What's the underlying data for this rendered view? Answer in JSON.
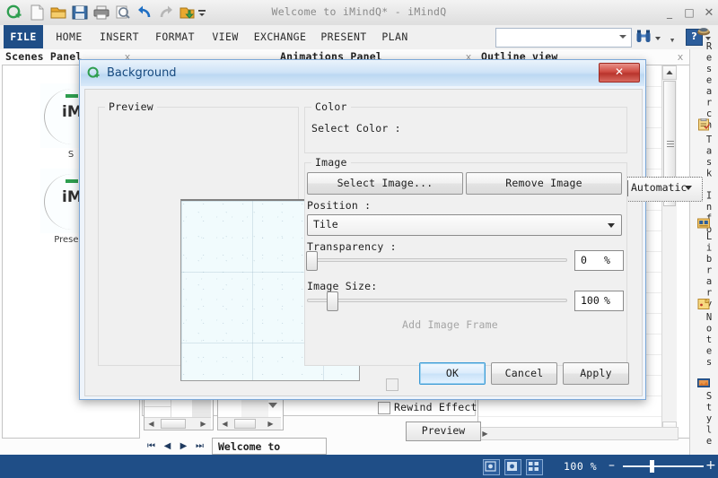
{
  "window": {
    "title": "Welcome to iMindQ* - iMindQ",
    "minimize": "_",
    "maximize": "□",
    "close": "✕"
  },
  "quick_access": {
    "icons": [
      "app-logo-icon",
      "new-document-icon",
      "open-folder-icon",
      "save-icon",
      "print-icon",
      "print-preview-icon",
      "undo-icon",
      "redo-icon",
      "export-icon",
      "toolbar-overflow-icon"
    ]
  },
  "ribbon": {
    "tabs": [
      {
        "label": "FILE",
        "active": true
      },
      {
        "label": "HOME",
        "active": false
      },
      {
        "label": "INSERT",
        "active": false
      },
      {
        "label": "FORMAT",
        "active": false
      },
      {
        "label": "VIEW",
        "active": false
      },
      {
        "label": "EXCHANGE",
        "active": false
      },
      {
        "label": "PRESENT",
        "active": false
      },
      {
        "label": "PLAN",
        "active": false
      }
    ],
    "search_value": "",
    "search_placeholder": "",
    "help_label": "?"
  },
  "panels": {
    "scenes": {
      "title": "Scenes Panel",
      "close": "x",
      "items": [
        {
          "logo": "iM",
          "label": "S"
        },
        {
          "logo": "iM",
          "label": "Present"
        }
      ]
    },
    "animations": {
      "title": "Animations Panel",
      "close": "x"
    },
    "outline": {
      "title": "Outline view",
      "close": "x"
    }
  },
  "animation_controls": {
    "rewind_label": "Rewind Effect",
    "rewind_checked": false,
    "preview_label": "Preview"
  },
  "navigation": {
    "first": "⏮",
    "prev": "◀",
    "next": "▶",
    "last": "⏭",
    "sheet_tab": "Welcome to"
  },
  "right_tabs": [
    {
      "label": "Research",
      "icon": "research-icon"
    },
    {
      "label": "Task Info",
      "icon": "task-info-icon"
    },
    {
      "label": "Library",
      "icon": "library-icon"
    },
    {
      "label": "Notes",
      "icon": "notes-icon"
    },
    {
      "label": "Style",
      "icon": "style-icon"
    }
  ],
  "status_bar": {
    "view_icons": [
      "fit-page-icon",
      "center-view-icon",
      "fit-selection-icon"
    ],
    "zoom_label": "100 %",
    "zoom_out": "–",
    "zoom_in": "+",
    "zoom_value": 100
  },
  "dialog": {
    "title": "Background",
    "icon": "imindq-logo-icon",
    "close": "✕",
    "preview": {
      "group_label": "Preview"
    },
    "color": {
      "group_label": "Color",
      "select_color_label": "Select Color :",
      "selected_color_text": "Automatic",
      "selected_color_hex": "#ffffff"
    },
    "image": {
      "group_label": "Image",
      "select_image_label": "Select Image...",
      "remove_image_label": "Remove Image",
      "position_label": "Position :",
      "position_value": "Tile",
      "transparency_label": "Transparency :",
      "transparency_value": "0",
      "transparency_unit": "%",
      "image_size_label": "Image Size:",
      "image_size_value": "100",
      "image_size_unit": "%",
      "add_frame_label": "Add Image Frame",
      "add_frame_checked": false,
      "add_frame_disabled": true
    },
    "buttons": {
      "ok": "OK",
      "cancel": "Cancel",
      "apply": "Apply"
    }
  },
  "colors": {
    "ribbon_active": "#1f4e87",
    "status_bar": "#1f4e87",
    "dialog_border": "#7ba7d7",
    "dialog_close": "#cf4b42",
    "default_button_border": "#3c9bd6"
  }
}
